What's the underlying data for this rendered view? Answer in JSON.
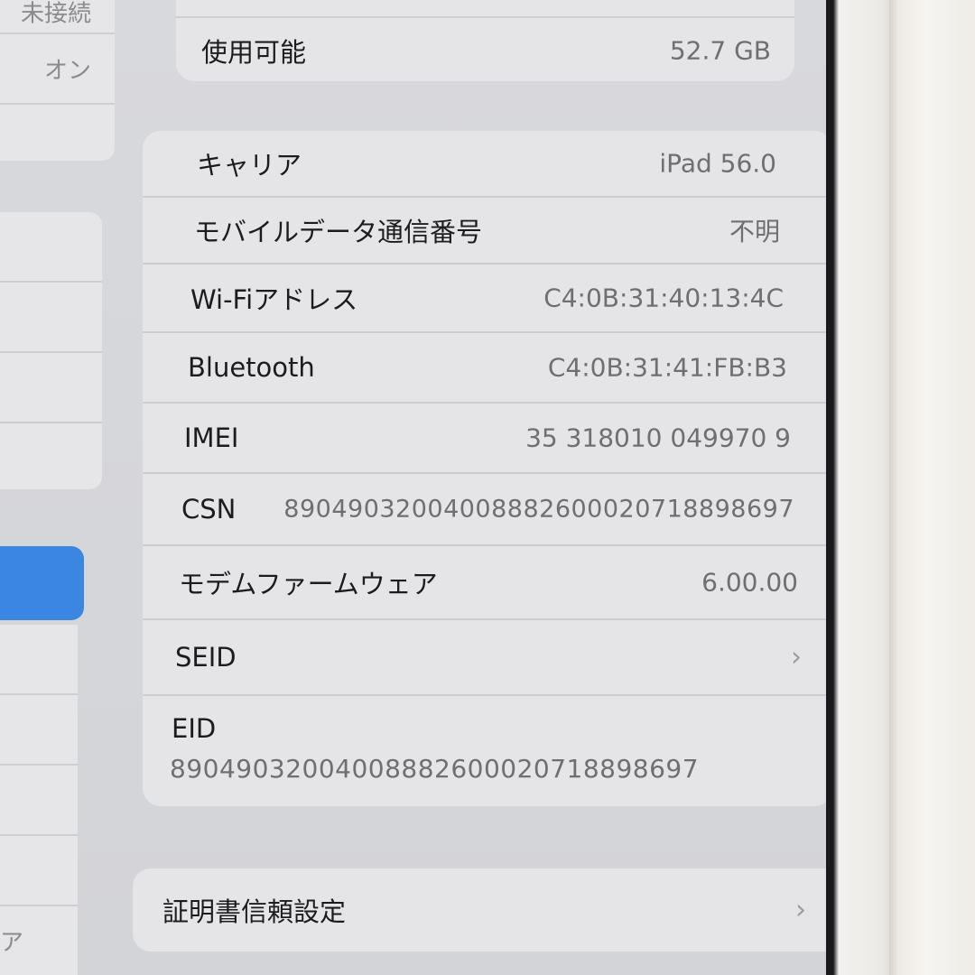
{
  "sidebar": {
    "top_partial_text": "未接続",
    "on_text": "オン",
    "bottom_partial_text": "ア"
  },
  "storage": {
    "available_label": "使用可能",
    "available_value": "52.7 GB"
  },
  "info": {
    "rows": [
      {
        "label": "キャリア",
        "value": "iPad 56.0"
      },
      {
        "label": "モバイルデータ通信番号",
        "value": "不明"
      },
      {
        "label": "Wi-Fiアドレス",
        "value": "C4:0B:31:40:13:4C"
      },
      {
        "label": "Bluetooth",
        "value": "C4:0B:31:41:FB:B3"
      },
      {
        "label": "IMEI",
        "value": "35 318010 049970 9"
      },
      {
        "label": "CSN",
        "value": "89049032004008882600020718898697"
      },
      {
        "label": "モデムファームウェア",
        "value": "6.00.00"
      },
      {
        "label": "SEID",
        "value": ""
      }
    ],
    "eid_label": "EID",
    "eid_value": "89049032004008882600020718898697"
  },
  "certificate": {
    "label": "証明書信頼設定"
  },
  "icons": {
    "chevron": "chevron-right-icon"
  }
}
